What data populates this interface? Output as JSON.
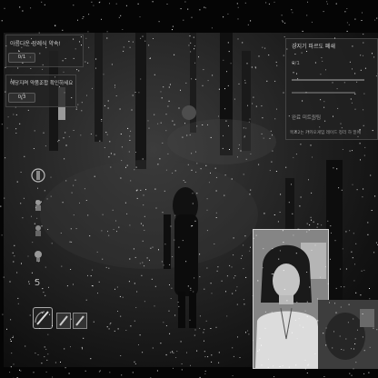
{
  "quest_left": {
    "title_1": "아름다운 장례식 약속!",
    "progress_1": "0/1",
    "title_2": "해당지역 약품조합 확인하세요",
    "progress_2": "0/3"
  },
  "quest_right": {
    "header": "강지기 파르도 폐쇄",
    "lines": [
      "0/1",
      "",
      "",
      "완료 미트링팀",
      "목표2는 카카오게임 레이드 정리 하 밑에"
    ]
  },
  "hud": {
    "skill_count": "5"
  },
  "colors": {
    "background": "#050505",
    "panel": "#232323",
    "text": "#cfcfcf"
  }
}
